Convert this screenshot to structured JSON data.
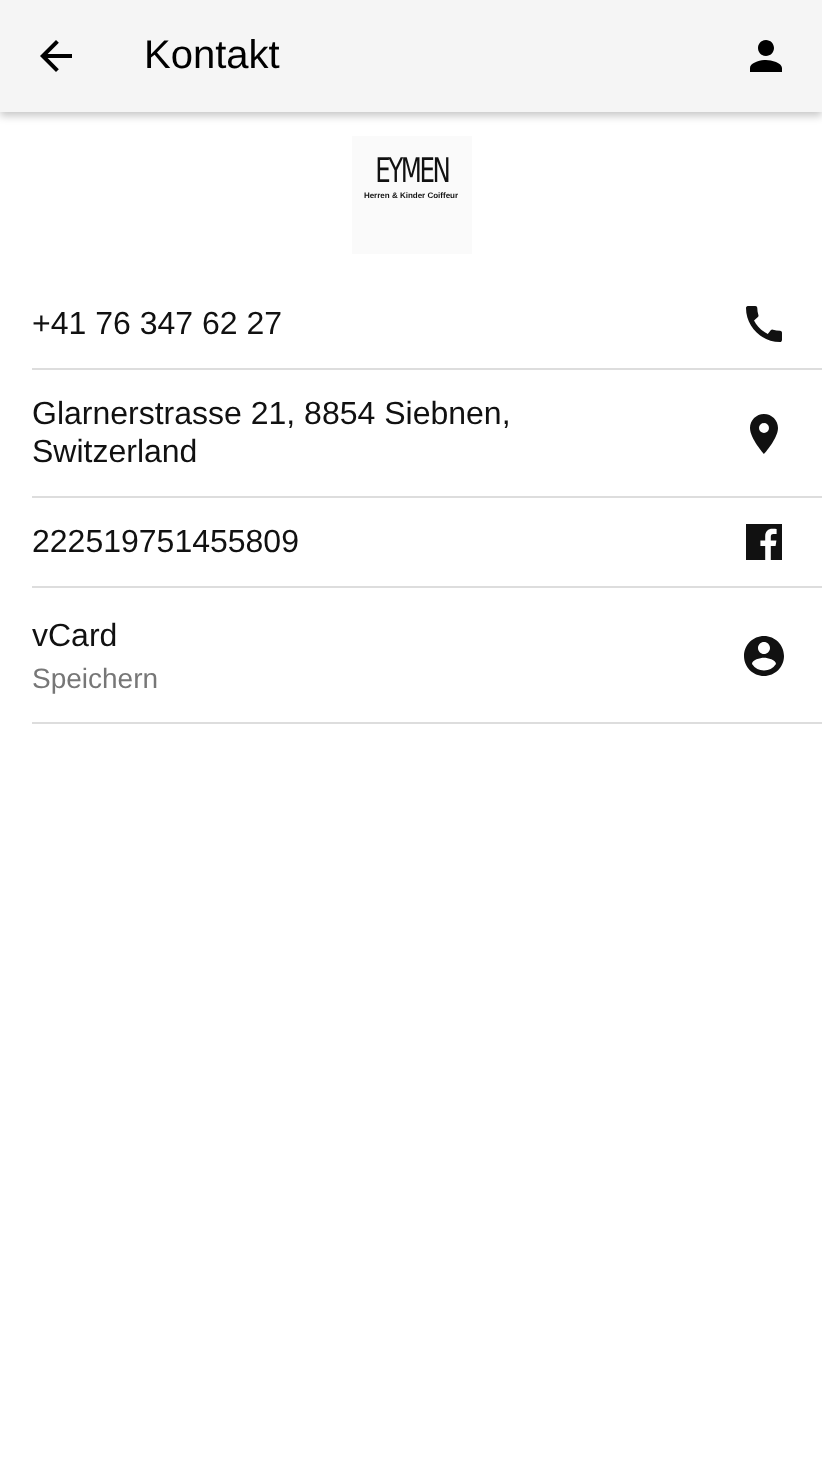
{
  "app_bar": {
    "title": "Kontakt"
  },
  "logo": {
    "name": "EYMEN",
    "tagline": "Herren & Kinder Coiffeur"
  },
  "contacts": [
    {
      "kind": "phone",
      "text": "+41 76 347 62 27"
    },
    {
      "kind": "address",
      "text": "Glarnerstrasse 21, 8854 Siebnen, Switzerland"
    },
    {
      "kind": "facebook",
      "text": "222519751455809"
    },
    {
      "kind": "vcard",
      "text": "vCard",
      "subtitle": "Speichern"
    }
  ]
}
